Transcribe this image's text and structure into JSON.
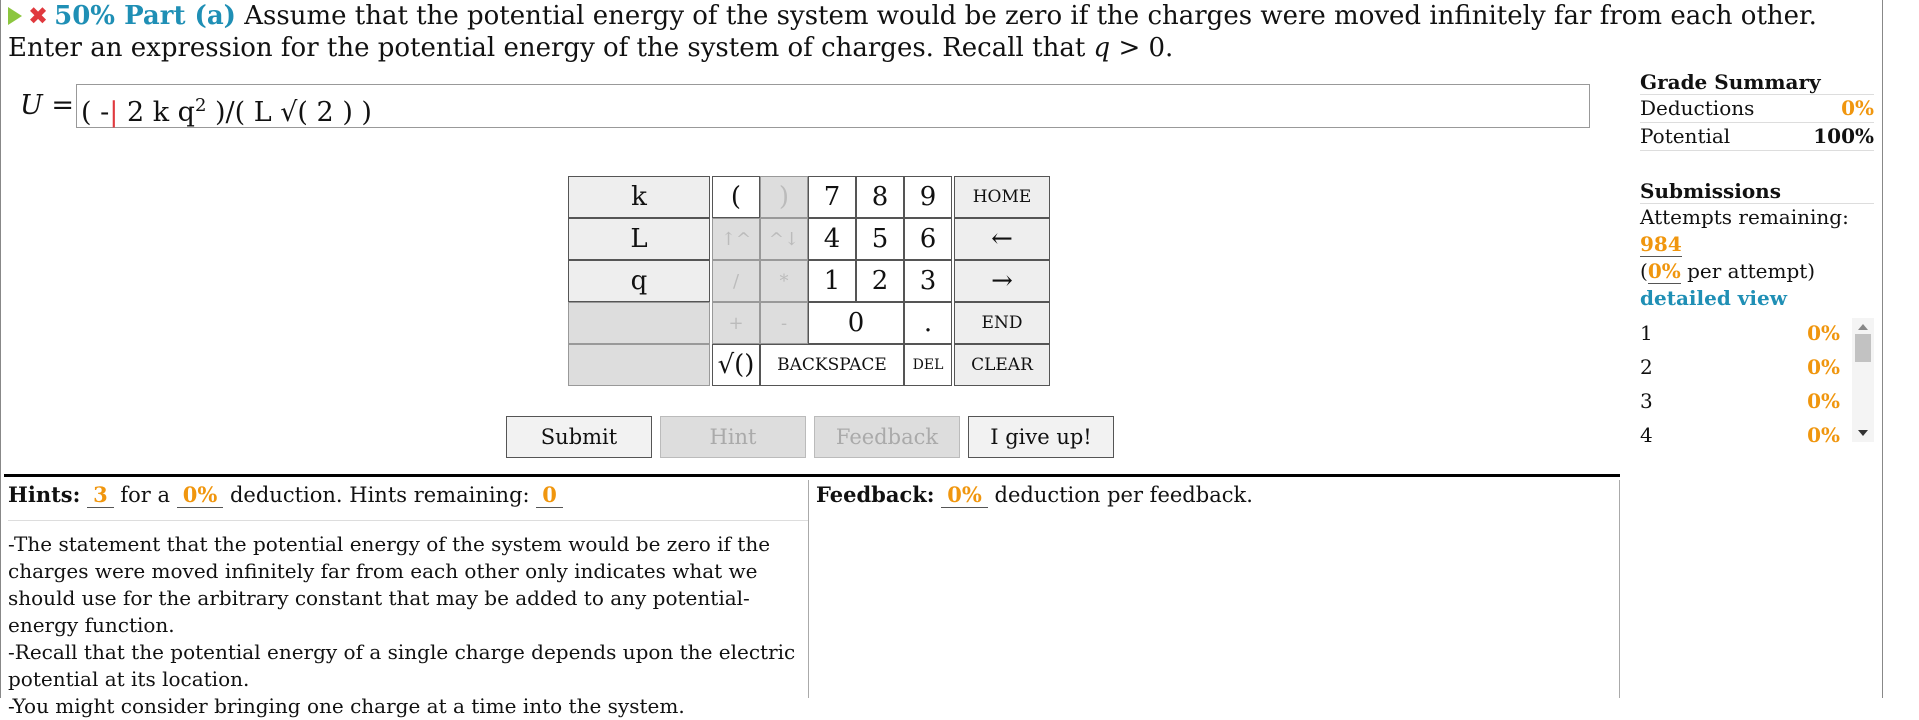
{
  "header": {
    "score": "50%",
    "part": "Part (a)",
    "question_start": "Assume that the potential energy of the system would be zero if the charges were moved infinitely far from each other. Enter an expression for the potential energy of the system of charges. Recall that ",
    "q_var": "q",
    "question_end": " > 0."
  },
  "answer": {
    "label": "U",
    "equals": " =",
    "pre_cursor": "( -",
    "cursor": "|",
    "post_cursor_a": " 2 k q",
    "sup": "2",
    "post_cursor_b": " )/( L √( 2 ) )"
  },
  "keypad": {
    "var_k": "k",
    "var_L": "L",
    "var_q": "q",
    "open_paren": "(",
    "close_paren": ")",
    "up_arrow": "↑^",
    "down_arrow": "^↓",
    "divide": "/",
    "multiply": "*",
    "plus": "+",
    "minus": "-",
    "sqrt": "√()",
    "d7": "7",
    "d8": "8",
    "d9": "9",
    "d4": "4",
    "d5": "5",
    "d6": "6",
    "d1": "1",
    "d2": "2",
    "d3": "3",
    "d0": "0",
    "dot": ".",
    "home": "HOME",
    "left": "←",
    "right": "→",
    "end": "END",
    "backspace": "BACKSPACE",
    "del": "DEL",
    "clear": "CLEAR"
  },
  "buttons": {
    "submit": "Submit",
    "hint": "Hint",
    "feedback": "Feedback",
    "give_up": "I give up!"
  },
  "hints_panel": {
    "title": "Hints:",
    "count": "3",
    "for_a": "for a",
    "deduction": "0%",
    "deduction_label": "deduction. Hints remaining:",
    "remaining": "0",
    "hint_lines": [
      "-The statement that the potential energy of the system would be zero if the charges were moved infinitely far from each other only indicates what we should use for the arbitrary constant that may be added to any potential-energy function.",
      "-Recall that the potential energy of a single charge depends upon the electric potential at its location.",
      "-You might consider bringing one charge at a time into the system."
    ]
  },
  "feedback_panel": {
    "title": "Feedback:",
    "deduction": "0%",
    "label": "deduction per feedback."
  },
  "sidebar": {
    "grade_title": "Grade Summary",
    "deductions_label": "Deductions",
    "deductions_value": "0%",
    "potential_label": "Potential",
    "potential_value": "100%",
    "submissions_title": "Submissions",
    "attempts_label": "Attempts remaining:",
    "attempts_value": "984",
    "per_open": "(",
    "per_value": "0%",
    "per_label": "per attempt)",
    "detailed_view": "detailed view",
    "submissions": [
      {
        "n": "1",
        "v": "0%"
      },
      {
        "n": "2",
        "v": "0%"
      },
      {
        "n": "3",
        "v": "0%"
      },
      {
        "n": "4",
        "v": "0%"
      }
    ]
  }
}
